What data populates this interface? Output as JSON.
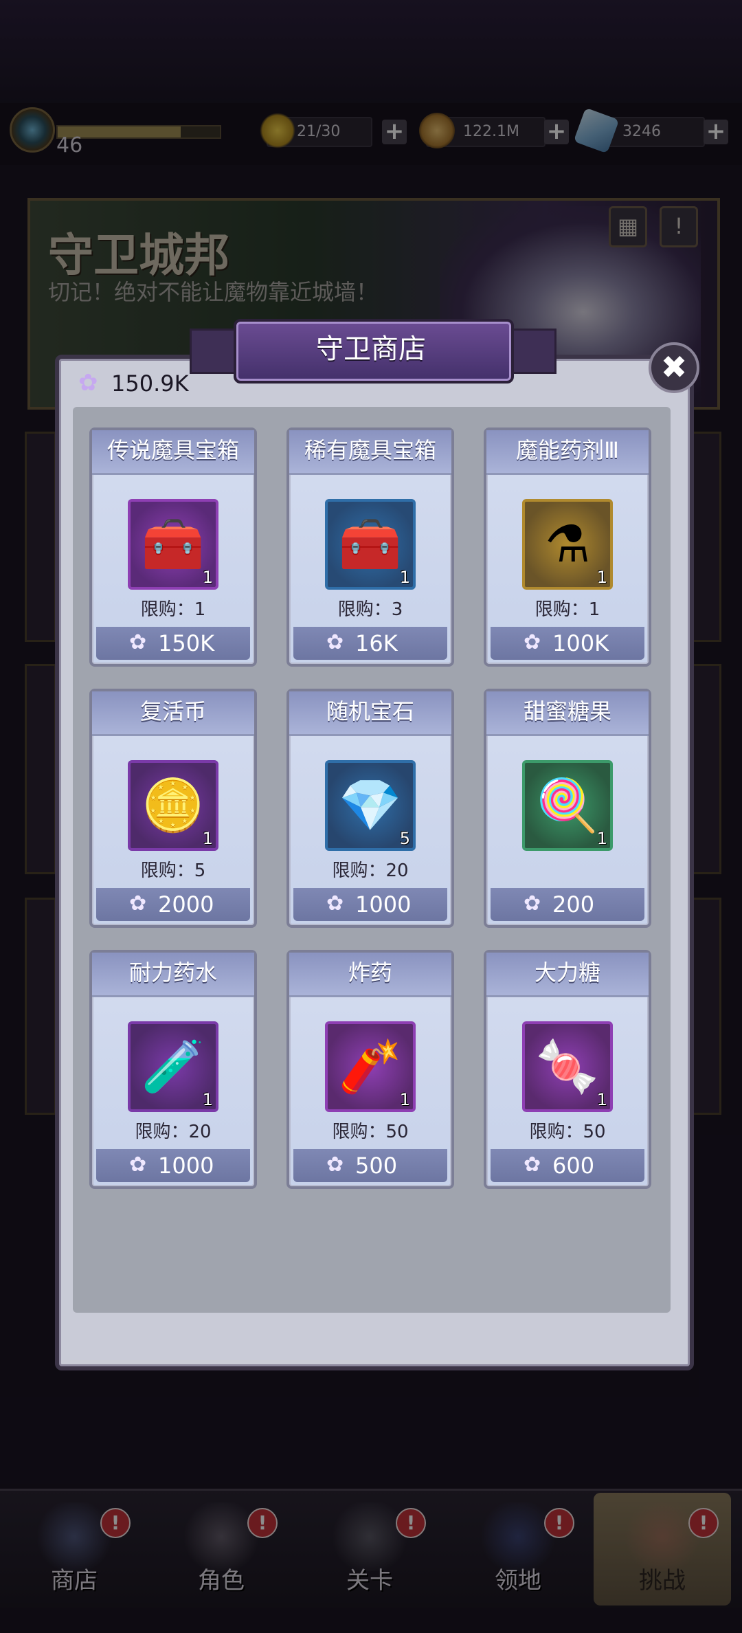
{
  "topbar": {
    "level": "46",
    "xp_fraction": 0.76,
    "energy": "21/30",
    "gold": "122.1M",
    "gems": "3246",
    "plus_label": "+"
  },
  "banner": {
    "title": "守卫城邦",
    "subtitle": "切记！绝对不能让魔物靠近城墙！",
    "rank_icon": "▦",
    "info_icon": "!"
  },
  "shop": {
    "title": "守卫商店",
    "close_icon": "✖",
    "currency_value": "150.9K",
    "flower_icon": "✿",
    "items": [
      {
        "name": "传说魔具宝箱",
        "icon": "legendary-chest-icon",
        "qty": "1",
        "limit": "限购：1",
        "price": "150K",
        "frame": "#8e3fb3",
        "bg": "#5a2a78",
        "emoji": "🧰"
      },
      {
        "name": "稀有魔具宝箱",
        "icon": "rare-chest-icon",
        "qty": "1",
        "limit": "限购：3",
        "price": "16K",
        "frame": "#2f6ea8",
        "bg": "#274a74",
        "emoji": "🧰"
      },
      {
        "name": "魔能药剂Ⅲ",
        "icon": "magic-potion-icon",
        "qty": "1",
        "limit": "限购：1",
        "price": "100K",
        "frame": "#b08a2e",
        "bg": "#6a5428",
        "emoji": "⚗"
      },
      {
        "name": "复活币",
        "icon": "revive-coin-icon",
        "qty": "1",
        "limit": "限购：5",
        "price": "2000",
        "frame": "#7a3aa8",
        "bg": "#4e2a6a",
        "emoji": "🪙"
      },
      {
        "name": "随机宝石",
        "icon": "random-gem-icon",
        "qty": "5",
        "limit": "限购：20",
        "price": "1000",
        "frame": "#2f6ea8",
        "bg": "#27466e",
        "emoji": "💎"
      },
      {
        "name": "甜蜜糖果",
        "icon": "sweet-candy-icon",
        "qty": "1",
        "limit": "",
        "price": "200",
        "frame": "#3c9a6a",
        "bg": "#2a5a40",
        "emoji": "🍭"
      },
      {
        "name": "耐力药水",
        "icon": "stamina-potion-icon",
        "qty": "1",
        "limit": "限购：20",
        "price": "1000",
        "frame": "#7a3aa8",
        "bg": "#4e2a6a",
        "emoji": "🧪"
      },
      {
        "name": "炸药",
        "icon": "dynamite-icon",
        "qty": "1",
        "limit": "限购：50",
        "price": "500",
        "frame": "#8e3fb3",
        "bg": "#5a2a6e",
        "emoji": "🧨"
      },
      {
        "name": "大力糖",
        "icon": "power-candy-icon",
        "qty": "1",
        "limit": "限购：50",
        "price": "600",
        "frame": "#8e3fb3",
        "bg": "#5a2a6e",
        "emoji": "🍬"
      }
    ]
  },
  "nav": {
    "items": [
      {
        "label": "商店",
        "badge": "!",
        "art": "#6a7ab0"
      },
      {
        "label": "角色",
        "badge": "!",
        "art": "#8a8290"
      },
      {
        "label": "关卡",
        "badge": "!",
        "art": "#7a7a86"
      },
      {
        "label": "领地",
        "badge": "!",
        "art": "#4a5aa0"
      },
      {
        "label": "挑战",
        "badge": "!",
        "art": "#b07060"
      }
    ]
  }
}
